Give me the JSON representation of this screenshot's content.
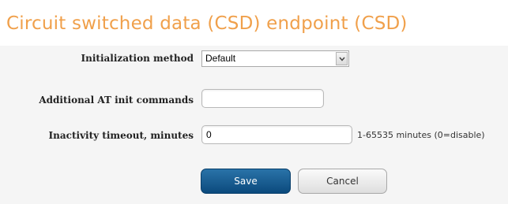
{
  "header": {
    "title": "Circuit switched data (CSD) endpoint (CSD)",
    "title_color": "#f0a04b"
  },
  "form": {
    "init_method": {
      "label": "Initialization method",
      "selected_value": "Default"
    },
    "at_init_commands": {
      "label": "Additional AT init commands",
      "value": ""
    },
    "inactivity_timeout": {
      "label": "Inactivity timeout, minutes",
      "value": "0",
      "hint": "1-65535 minutes (0=disable)"
    }
  },
  "buttons": {
    "save_label": "Save",
    "cancel_label": "Cancel",
    "save_color": "#0d4f86"
  },
  "icons": {
    "select_arrow": "chevron-down-icon"
  }
}
